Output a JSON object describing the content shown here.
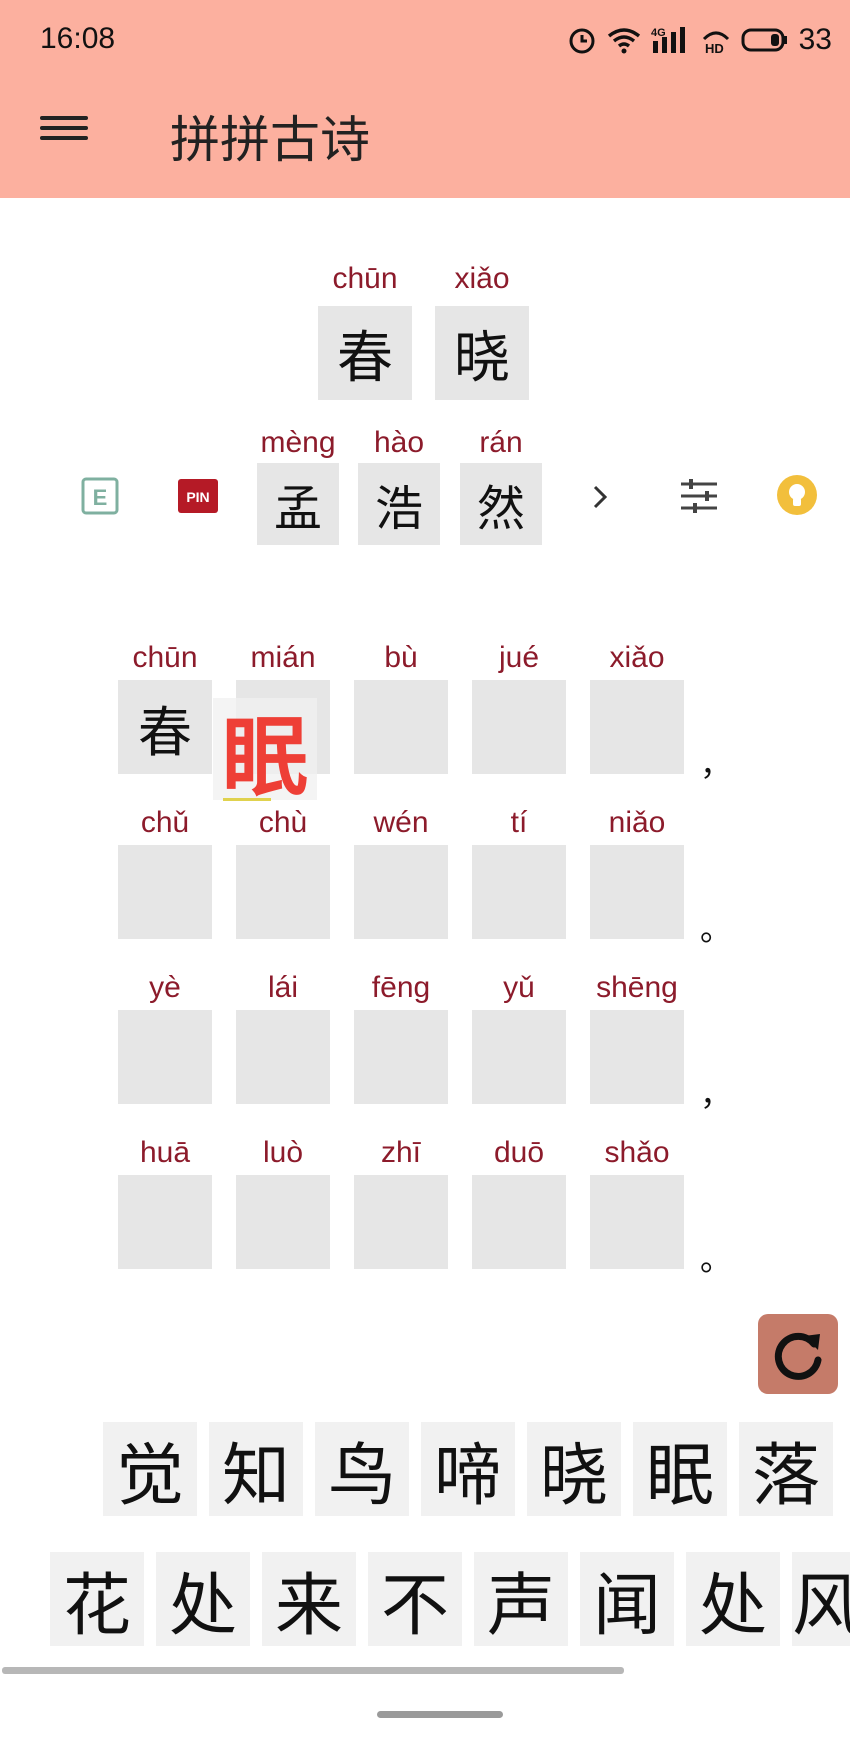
{
  "status": {
    "time": "16:08",
    "battery": "33",
    "network": "4G"
  },
  "app": {
    "title": "拼拼古诗"
  },
  "poem": {
    "title": [
      {
        "pinyin": "chūn",
        "char": "春"
      },
      {
        "pinyin": "xiǎo",
        "char": "晓"
      }
    ],
    "author": [
      {
        "pinyin": "mèng",
        "char": "孟"
      },
      {
        "pinyin": "hào",
        "char": "浩"
      },
      {
        "pinyin": "rán",
        "char": "然"
      }
    ],
    "lines": [
      {
        "cells": [
          {
            "pinyin": "chūn",
            "char": "春"
          },
          {
            "pinyin": "mián",
            "char": ""
          },
          {
            "pinyin": "bù",
            "char": ""
          },
          {
            "pinyin": "jué",
            "char": ""
          },
          {
            "pinyin": "xiǎo",
            "char": ""
          }
        ],
        "punct": "，"
      },
      {
        "cells": [
          {
            "pinyin": "chǔ",
            "char": ""
          },
          {
            "pinyin": "chù",
            "char": ""
          },
          {
            "pinyin": "wén",
            "char": ""
          },
          {
            "pinyin": "tí",
            "char": ""
          },
          {
            "pinyin": "niǎo",
            "char": ""
          }
        ],
        "punct": "。"
      },
      {
        "cells": [
          {
            "pinyin": "yè",
            "char": ""
          },
          {
            "pinyin": "lái",
            "char": ""
          },
          {
            "pinyin": "fēng",
            "char": ""
          },
          {
            "pinyin": "yǔ",
            "char": ""
          },
          {
            "pinyin": "shēng",
            "char": ""
          }
        ],
        "punct": "，"
      },
      {
        "cells": [
          {
            "pinyin": "huā",
            "char": ""
          },
          {
            "pinyin": "luò",
            "char": ""
          },
          {
            "pinyin": "zhī",
            "char": ""
          },
          {
            "pinyin": "duō",
            "char": ""
          },
          {
            "pinyin": "shǎo",
            "char": ""
          }
        ],
        "punct": "。"
      }
    ]
  },
  "dragging": {
    "char": "眠"
  },
  "toolbar": {
    "e_label": "E",
    "pin_label": "PIN"
  },
  "keyboard": {
    "row1": [
      "觉",
      "知",
      "鸟",
      "啼",
      "晓",
      "眠",
      "落"
    ],
    "row2": [
      "花",
      "处",
      "来",
      "不",
      "声",
      "闻",
      "处",
      "风"
    ]
  },
  "colors": {
    "header": "#fcb09f",
    "pinyin": "#8c1b2b",
    "dragging": "#ee3f36",
    "refresh": "#c57b69",
    "bulb": "#f2bf3c"
  }
}
